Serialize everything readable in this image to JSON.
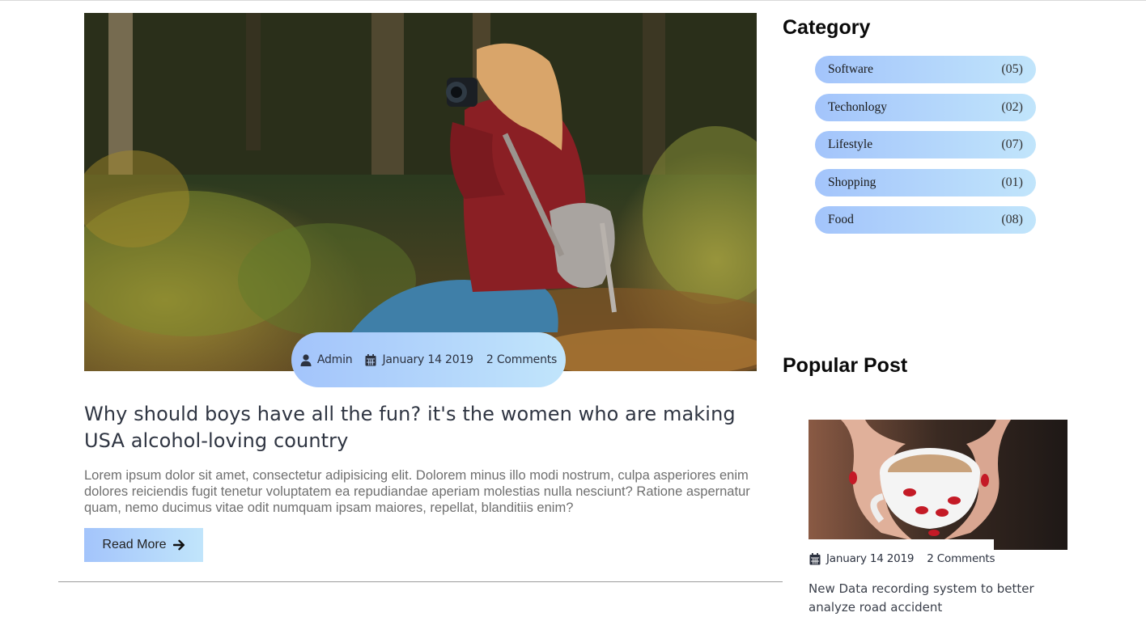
{
  "post": {
    "author": "Admin",
    "date": "January 14 2019",
    "comments": "2 Comments",
    "title": "Why should boys have all the fun? it's the women who are making USA alcohol-loving country",
    "excerpt": "Lorem ipsum dolor sit amet, consectetur adipisicing elit. Dolorem minus illo modi nostrum, culpa asperiores enim dolores reiciendis fugit tenetur voluptatem ea repudiandae aperiam molestias nulla nesciunt? Ratione aspernatur quam, nemo ducimus vitae odit numquam ipsam maiores, repellat, blanditiis enim?",
    "read_more_label": "Read More"
  },
  "sidebar": {
    "category_title": "Category",
    "categories": [
      {
        "name": "Software",
        "count": "(05)"
      },
      {
        "name": "Techonlogy",
        "count": "(02)"
      },
      {
        "name": "Lifestyle",
        "count": "(07)"
      },
      {
        "name": "Shopping",
        "count": "(01)"
      },
      {
        "name": "Food",
        "count": "(08)"
      }
    ],
    "popular_title": "Popular Post",
    "popular_post": {
      "date": "January 14 2019",
      "comments": "2 Comments",
      "title": "New Data recording system to better analyze road accident"
    }
  },
  "colors": {
    "accent_start": "#a3c4fb",
    "accent_end": "#c1e5fb"
  }
}
